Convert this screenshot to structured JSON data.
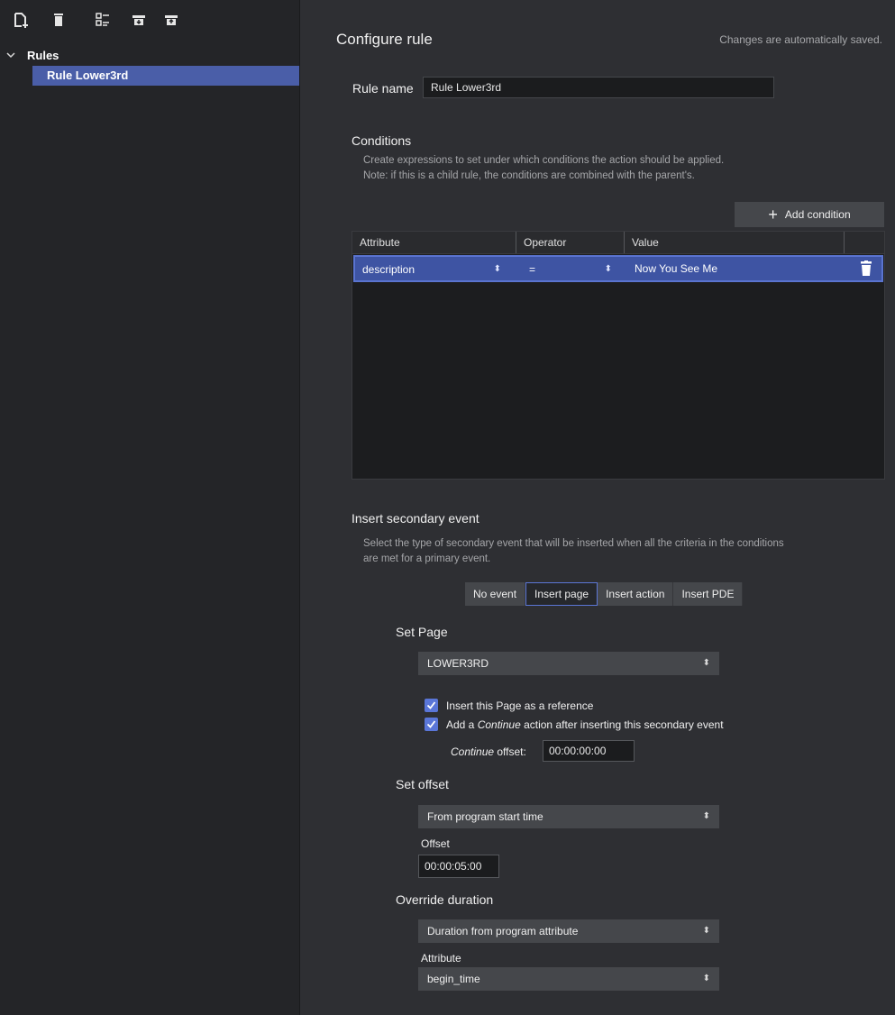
{
  "toolbar": {
    "icons": [
      "new-rule-icon",
      "delete-icon",
      "tree-view-icon",
      "move-down-icon",
      "move-up-icon"
    ]
  },
  "tree": {
    "root_label": "Rules",
    "items": [
      {
        "label": "Rule Lower3rd",
        "selected": true
      }
    ]
  },
  "main": {
    "title": "Configure rule",
    "autosave_note": "Changes are automatically saved.",
    "rule_name_label": "Rule name",
    "rule_name_value": "Rule Lower3rd"
  },
  "conditions": {
    "title": "Conditions",
    "desc_line1": "Create expressions to set under which conditions the action should be applied.",
    "desc_line2": "Note: if this is a child rule, the conditions are combined with the parent's.",
    "add_button": "Add condition",
    "columns": [
      "Attribute",
      "Operator",
      "Value"
    ],
    "rows": [
      {
        "attribute": "description",
        "operator": "=",
        "value": "Now You See Me"
      }
    ]
  },
  "secondary": {
    "title": "Insert secondary event",
    "desc_line1": "Select the type of secondary event that will be inserted when all the criteria in the conditions",
    "desc_line2": "are met for a primary event.",
    "tabs": [
      "No event",
      "Insert page",
      "Insert action",
      "Insert PDE"
    ],
    "active_tab": "Insert page"
  },
  "set_page": {
    "title": "Set Page",
    "page_value": "LOWER3RD",
    "checkbox1_label": "Insert this Page as a reference",
    "checkbox2_prefix": "Add a ",
    "checkbox2_em": "Continue",
    "checkbox2_suffix": " action after inserting this secondary event",
    "continue_label_em": "Continue",
    "continue_label_suffix": " offset:",
    "continue_offset": "00:00:00:00"
  },
  "set_offset": {
    "title": "Set offset",
    "mode": "From program start time",
    "offset_label": "Offset",
    "offset_value": "00:00:05:00"
  },
  "override_duration": {
    "title": "Override duration",
    "mode": "Duration from program attribute",
    "attribute_label": "Attribute",
    "attribute_value": "begin_time"
  },
  "colors": {
    "selection": "#4a5ea8",
    "accent": "#5a76d8",
    "background": "#2e2f33"
  }
}
